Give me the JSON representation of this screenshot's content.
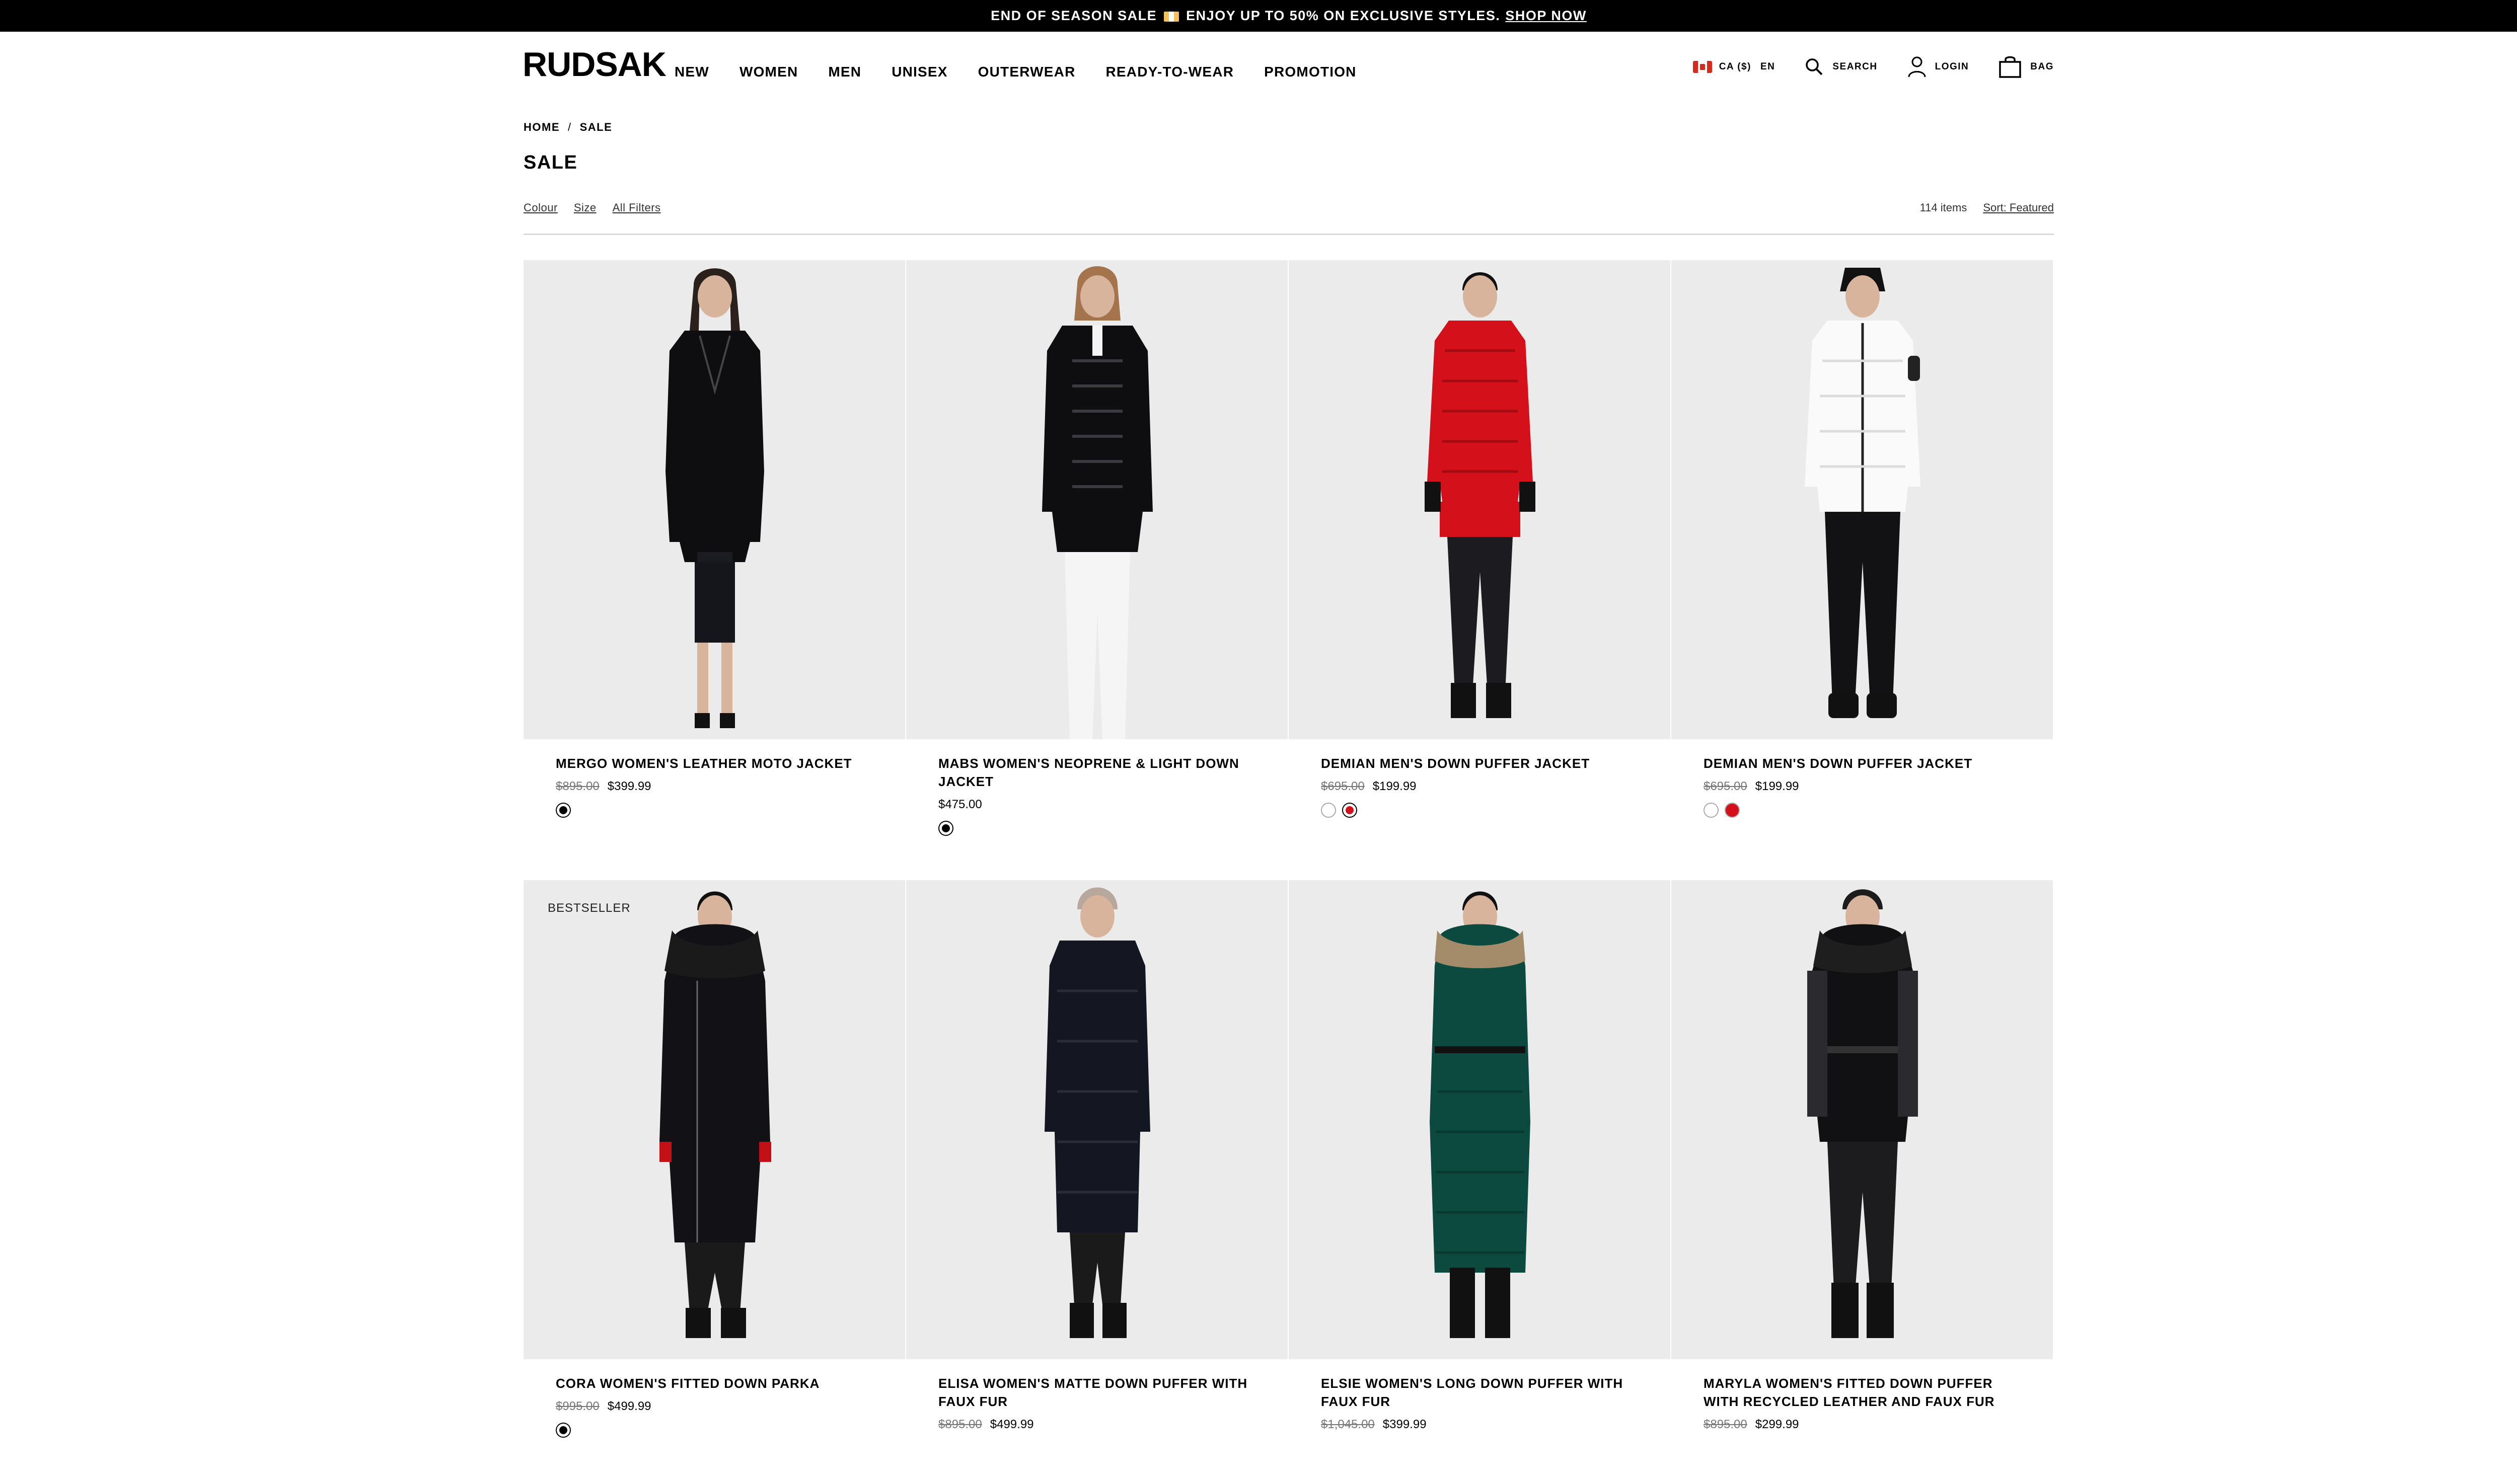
{
  "announcement": {
    "text": "END OF SEASON SALE",
    "text2": "ENJOY UP TO 50% ON EXCLUSIVE STYLES.",
    "link": "SHOP NOW"
  },
  "header": {
    "logo": "RUDSAK",
    "nav": [
      "NEW",
      "WOMEN",
      "MEN",
      "UNISEX",
      "OUTERWEAR",
      "READY-TO-WEAR",
      "PROMOTION"
    ],
    "locale": "CA ($)",
    "language": "EN",
    "search": "SEARCH",
    "login": "LOGIN",
    "bag": "BAG"
  },
  "breadcrumb": [
    "HOME",
    "SALE"
  ],
  "page_title": "SALE",
  "filters": [
    "Colour",
    "Size",
    "All Filters"
  ],
  "results": {
    "count": "114 items",
    "sort": "Sort: Featured"
  },
  "products": [
    {
      "name": "MERGO WOMEN'S LEATHER MOTO JACKET",
      "old_price": "$895.00",
      "price": "$399.99",
      "badge": "",
      "swatches": [
        "#000000"
      ]
    },
    {
      "name": "MABS WOMEN'S NEOPRENE & LIGHT DOWN JACKET",
      "old_price": "",
      "price": "$475.00",
      "badge": "",
      "swatches": [
        "#000000"
      ]
    },
    {
      "name": "DEMIAN MEN'S DOWN PUFFER JACKET",
      "old_price": "$695.00",
      "price": "$199.99",
      "badge": "",
      "swatches": [
        "#ffffff",
        "#d4111a"
      ]
    },
    {
      "name": "DEMIAN MEN'S DOWN PUFFER JACKET",
      "old_price": "$695.00",
      "price": "$199.99",
      "badge": "",
      "swatches": [
        "#ffffff",
        "#d4111a"
      ]
    },
    {
      "name": "CORA WOMEN'S FITTED DOWN PARKA",
      "old_price": "$995.00",
      "price": "$499.99",
      "badge": "BESTSELLER",
      "swatches": [
        "#000000"
      ]
    },
    {
      "name": "ELISA WOMEN'S MATTE DOWN PUFFER WITH FAUX FUR",
      "old_price": "$895.00",
      "price": "$499.99",
      "badge": "",
      "swatches": []
    },
    {
      "name": "ELSIE WOMEN'S LONG DOWN PUFFER WITH FAUX FUR",
      "old_price": "$1,045.00",
      "price": "$399.99",
      "badge": "",
      "swatches": []
    },
    {
      "name": "MARYLA WOMEN'S FITTED DOWN PUFFER WITH RECYCLED LEATHER AND FAUX FUR",
      "old_price": "$895.00",
      "price": "$299.99",
      "badge": "",
      "swatches": []
    }
  ],
  "colors": {
    "accent": "#000000",
    "background": "#ffffff",
    "photo_bg": "#ebebeb",
    "sale_red": "#d4111a"
  }
}
